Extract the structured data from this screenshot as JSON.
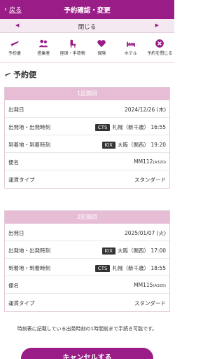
{
  "header": {
    "back_label": "戻る",
    "back_chev": "‹",
    "title": "予約確認・変更"
  },
  "closebar": {
    "left_arrow": "◀",
    "right_arrow": "▶",
    "label": "閉じる"
  },
  "nav": {
    "items": [
      {
        "label": "予約便",
        "icon": "plane-icon"
      },
      {
        "label": "搭乗者",
        "icon": "people-icon"
      },
      {
        "label": "座席・手荷物",
        "icon": "seat-icon"
      },
      {
        "label": "保険",
        "icon": "heart-icon"
      },
      {
        "label": "ホテル",
        "icon": "bed-icon"
      },
      {
        "label": "予約を閉じる",
        "icon": "close-circle-icon"
      }
    ]
  },
  "section": {
    "title": "予約便"
  },
  "segments": [
    {
      "header": "1区間目",
      "date_label": "出発日",
      "date_value": "2024/12/26 (木)",
      "dep_label": "出発地・出発時刻",
      "dep_code": "CTS",
      "dep_city": "札幌（新千歳）",
      "dep_time": "16:55",
      "arr_label": "到着地・到着時刻",
      "arr_code": "KIX",
      "arr_city": "大阪（関西）",
      "arr_time": "19:20",
      "flight_label": "便名",
      "flight_no": "MM112",
      "aircraft": "(A320)",
      "fare_label": "運賃タイプ",
      "fare_value": "スタンダード"
    },
    {
      "header": "2区間目",
      "date_label": "出発日",
      "date_value": "2025/01/07 (火)",
      "dep_label": "出発地・出発時刻",
      "dep_code": "KIX",
      "dep_city": "大阪（関西）",
      "dep_time": "17:00",
      "arr_label": "到着地・到着時刻",
      "arr_code": "CTS",
      "arr_city": "札幌（新千歳）",
      "arr_time": "18:55",
      "flight_label": "便名",
      "flight_no": "MM115",
      "aircraft": "(A320)",
      "fare_label": "運賃タイプ",
      "fare_value": "スタンダード"
    }
  ],
  "note": "時刻表に記載している出発時刻の1時間前まで手続き可能です。",
  "bottom_button": "キャンセルする",
  "colors": {
    "brand": "#9a1c87",
    "segment_header": "#e6bdd5"
  }
}
